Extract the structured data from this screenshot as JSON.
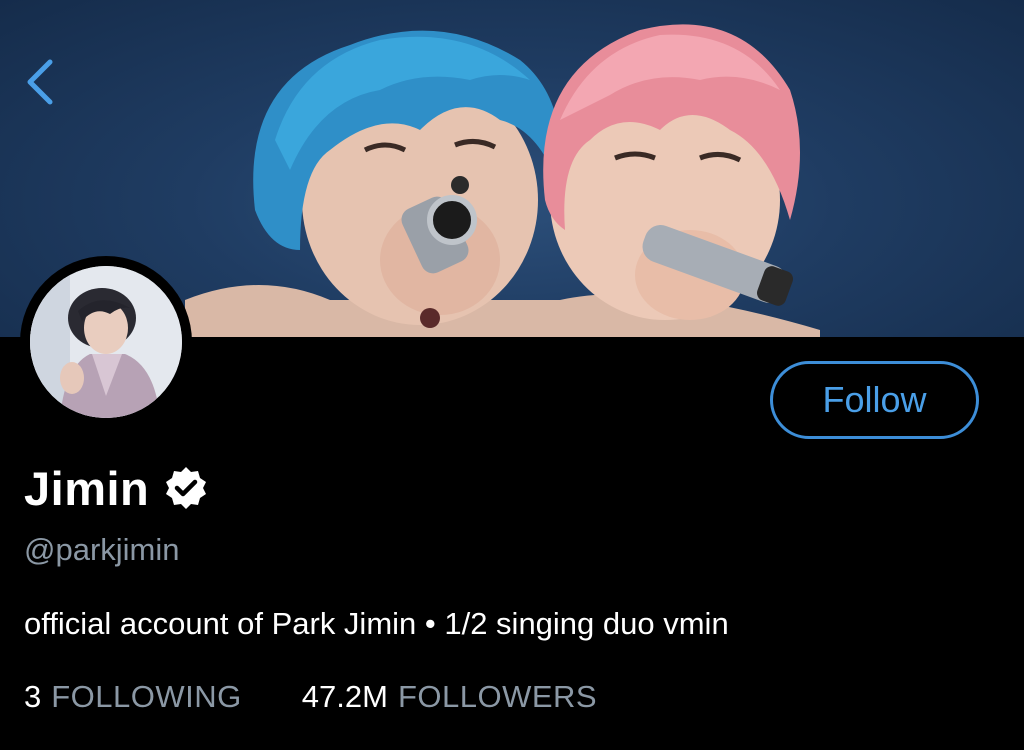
{
  "profile": {
    "name": "Jimin",
    "handle": "@parkjimin",
    "bio": "official account of Park Jimin • 1/2 singing duo vmin",
    "verified": true
  },
  "actions": {
    "follow_label": "Follow",
    "back_icon": "chevron-left-icon"
  },
  "stats": {
    "following_count": "3",
    "following_label": "FOLLOWING",
    "followers_count": "47.2M",
    "followers_label": "FOLLOWERS"
  },
  "colors": {
    "background": "#000000",
    "accent": "#4a9fe8",
    "secondary_text": "#8b98a5",
    "primary_text": "#ffffff"
  }
}
